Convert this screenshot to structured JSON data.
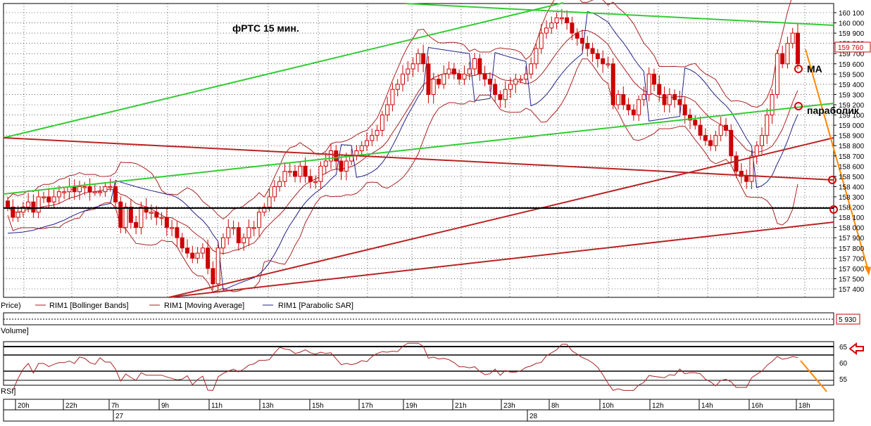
{
  "chart_data": {
    "type": "candlestick",
    "title": "фРТС   15 мин.",
    "instrument": "RIM1",
    "price_axis": {
      "ticks": [
        "160 100",
        "160 000",
        "159 900",
        "159 800",
        "159 700",
        "159 600",
        "159 500",
        "159 400",
        "159 300",
        "159 200",
        "159 100",
        "159 000",
        "158 900",
        "158 800",
        "158 700",
        "158 600",
        "158 500",
        "158 400",
        "158 300",
        "158 200",
        "158 100",
        "158 000",
        "157 900",
        "157 800",
        "157 700",
        "157 600",
        "157 500",
        "157 400"
      ],
      "range": [
        157350,
        160150
      ],
      "last_price_label": "159 760"
    },
    "time_axis": {
      "hour_labels": [
        "20h",
        "22h",
        "7h",
        "9h",
        "11h",
        "13h",
        "15h",
        "17h",
        "19h",
        "21h",
        "23h",
        "8h",
        "10h",
        "12h",
        "14h",
        "16h",
        "18h"
      ],
      "date_labels": [
        "27",
        "28"
      ]
    },
    "legend": {
      "price": "Price)",
      "bollinger": "RIM1 [Bollinger Bands]",
      "ma": "RIM1 [Moving Average]",
      "sar": "RIM1 [Parabolic SAR]"
    },
    "volume": {
      "label": "Volume]",
      "value": "5 930"
    },
    "rsi": {
      "label": "RSI]",
      "ticks": [
        "65",
        "60",
        "55"
      ]
    },
    "annotations": {
      "ma": "MA",
      "parabolic": "параболик"
    },
    "colors": {
      "candle": "#cc0000",
      "bollinger": "#aa2222",
      "ma": "#aa2222",
      "sar": "#222288",
      "trend_green": "#33cc33",
      "trend_red": "#bb2222",
      "level": "#000000",
      "forecast": "#ff8800"
    },
    "closes": [
      158200,
      158100,
      158150,
      158200,
      158250,
      158150,
      158300,
      158300,
      158250,
      158300,
      158350,
      158350,
      158400,
      158350,
      158400,
      158400,
      158350,
      158350,
      158350,
      158400,
      158400,
      158250,
      158000,
      158200,
      158050,
      158000,
      158200,
      158150,
      158150,
      158100,
      158100,
      158000,
      158000,
      157900,
      157800,
      157750,
      157700,
      157750,
      157800,
      157600,
      157450,
      157800,
      157900,
      158000,
      158000,
      157850,
      157900,
      158000,
      158000,
      158150,
      158200,
      158300,
      158400,
      158450,
      158550,
      158550,
      158500,
      158600,
      158500,
      158450,
      158450,
      158600,
      158650,
      158750,
      158650,
      158550,
      158650,
      158700,
      158750,
      158800,
      158850,
      158900,
      158950,
      159100,
      159200,
      159350,
      159400,
      159500,
      159550,
      159600,
      159700,
      159600,
      159300,
      159450,
      159400,
      159500,
      159550,
      159500,
      159450,
      159500,
      159550,
      159650,
      159500,
      159450,
      159400,
      159300,
      159250,
      159350,
      159400,
      159450,
      159450,
      159500,
      159600,
      159750,
      159900,
      159950,
      160000,
      160050,
      160050,
      160000,
      159900,
      159850,
      159800,
      159750,
      159700,
      159650,
      159600,
      159600,
      159200,
      159300,
      159200,
      159150,
      159100,
      159250,
      159300,
      159500,
      159400,
      159300,
      159200,
      159300,
      159250,
      159200,
      159100,
      159050,
      159000,
      158900,
      158850,
      158800,
      158900,
      159000,
      158950,
      158700,
      158550,
      158500,
      158450,
      158700,
      158800,
      158900,
      159100,
      159300,
      159700,
      159600,
      159800,
      159900,
      159600
    ]
  }
}
